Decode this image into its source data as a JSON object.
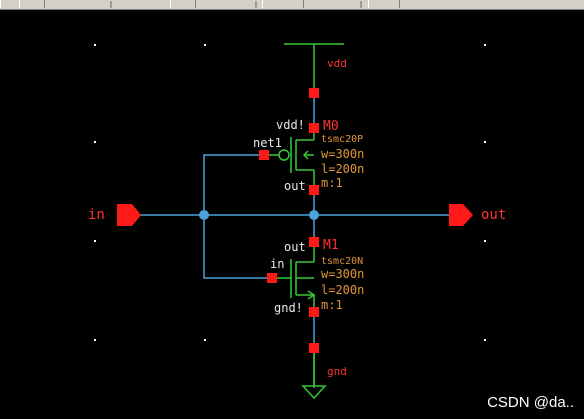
{
  "schematic": {
    "nets": {
      "vdd": "vdd",
      "gnd": "gnd",
      "in": "in",
      "out": "out"
    },
    "pmos": {
      "instance": "M0",
      "model": "tsmc20P",
      "w": "w=300n",
      "l": "l=200n",
      "m": "m:1",
      "pin_bulk": "vdd!",
      "pin_gate": "net1",
      "pin_drain": "out"
    },
    "nmos": {
      "instance": "M1",
      "model": "tsmc20N",
      "w": "w=300n",
      "l": "l=200n",
      "m": "m:1",
      "pin_drain": "out",
      "pin_gate": "in",
      "pin_source": "gnd!"
    }
  },
  "watermark": "CSDN @da..",
  "colors": {
    "background": "#000000",
    "wire": "#4aa3d8",
    "pin": "#ff1a1a",
    "device": "#37c837",
    "label": "#ff3030",
    "property": "#e0953a",
    "grid_dot": "#ffffff"
  }
}
